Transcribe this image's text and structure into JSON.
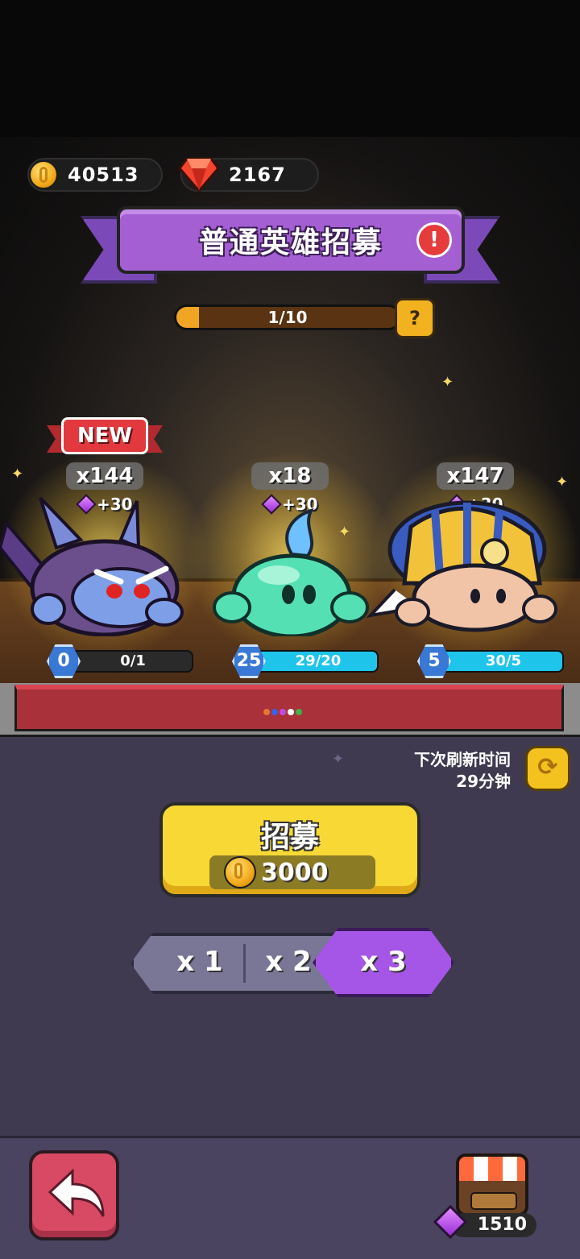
{
  "currency": {
    "gold": "40513",
    "gems": "2167"
  },
  "banner": {
    "title": "普通英雄招募",
    "alert_symbol": "!"
  },
  "progress": {
    "text": "1/10",
    "fraction": 0.1,
    "help_symbol": "?"
  },
  "heroes": [
    {
      "new_tag": "NEW",
      "count": "x144",
      "gem_reward": "+30",
      "level": "0",
      "cards": "0/1",
      "card_fraction": 0
    },
    {
      "count": "x18",
      "gem_reward": "+30",
      "level": "25",
      "cards": "29/20",
      "card_fraction": 1
    },
    {
      "count": "x147",
      "gem_reward": "+30",
      "level": "5",
      "cards": "30/5",
      "card_fraction": 1
    }
  ],
  "page_dots": [
    "#e8762e",
    "#3a62e8",
    "#c24be0",
    "#ffffff",
    "#3fb34f"
  ],
  "refresh": {
    "label": "下次刷新时间",
    "time": "29分钟"
  },
  "recruit": {
    "label": "招募",
    "cost": "3000"
  },
  "multiplier": {
    "options": [
      "x 1",
      "x 2",
      "x 3"
    ],
    "selected": "x 3"
  },
  "footer": {
    "shop_gems": "1510"
  },
  "colors": {
    "accent_purple": "#a45fd3",
    "gold": "#f7d835",
    "back_red": "#d84a64"
  }
}
